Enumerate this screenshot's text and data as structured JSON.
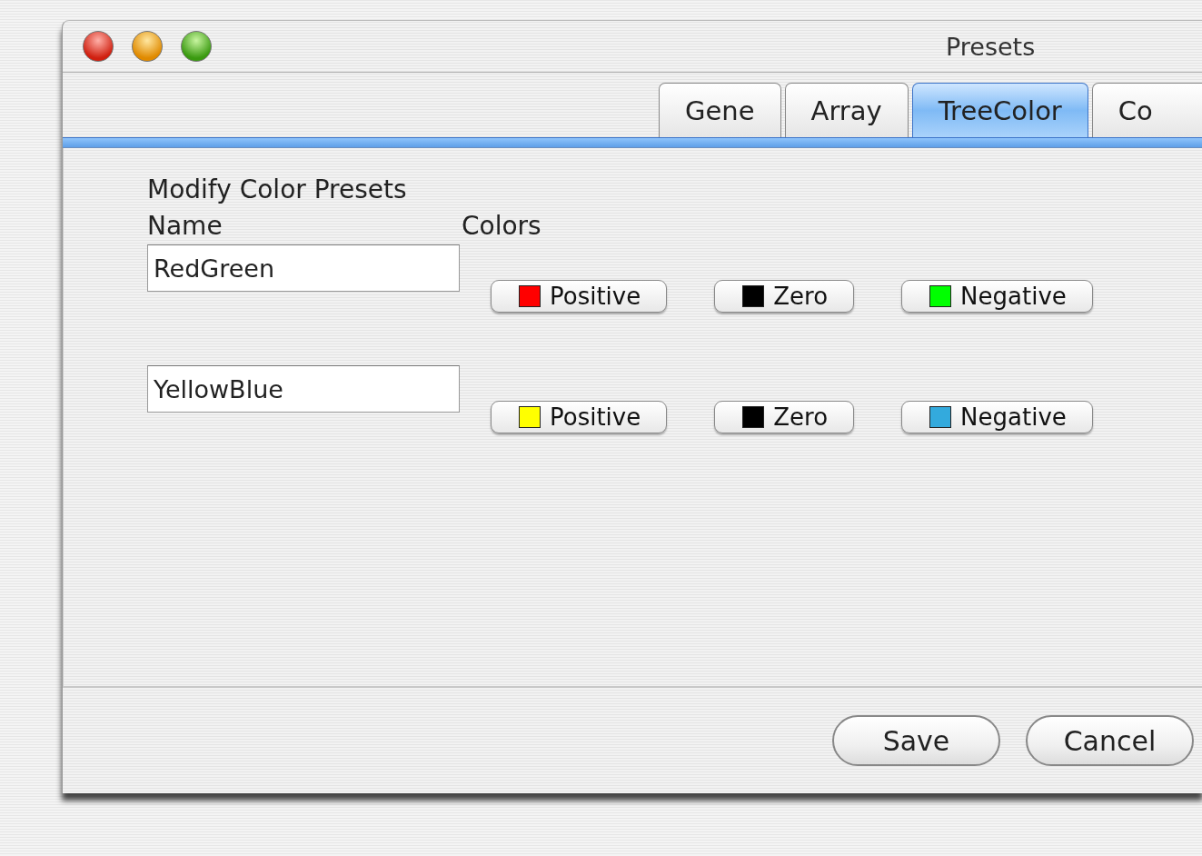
{
  "window": {
    "title": "Presets"
  },
  "tabs": [
    {
      "label": "Gene",
      "selected": false
    },
    {
      "label": "Array",
      "selected": false
    },
    {
      "label": "TreeColor",
      "selected": true
    },
    {
      "label": "Co",
      "selected": false
    }
  ],
  "panel": {
    "heading": "Modify Color Presets",
    "name_label": "Name",
    "colors_label": "Colors",
    "presets": [
      {
        "name": "RedGreen",
        "colors": [
          {
            "label": "Positive",
            "color": "#ff0000"
          },
          {
            "label": "Zero",
            "color": "#000000"
          },
          {
            "label": "Negative",
            "color": "#00ff00"
          }
        ]
      },
      {
        "name": "YellowBlue",
        "colors": [
          {
            "label": "Positive",
            "color": "#ffff00"
          },
          {
            "label": "Zero",
            "color": "#000000"
          },
          {
            "label": "Negative",
            "color": "#33aadd"
          }
        ]
      }
    ]
  },
  "buttons": [
    "Save",
    "Cancel"
  ]
}
